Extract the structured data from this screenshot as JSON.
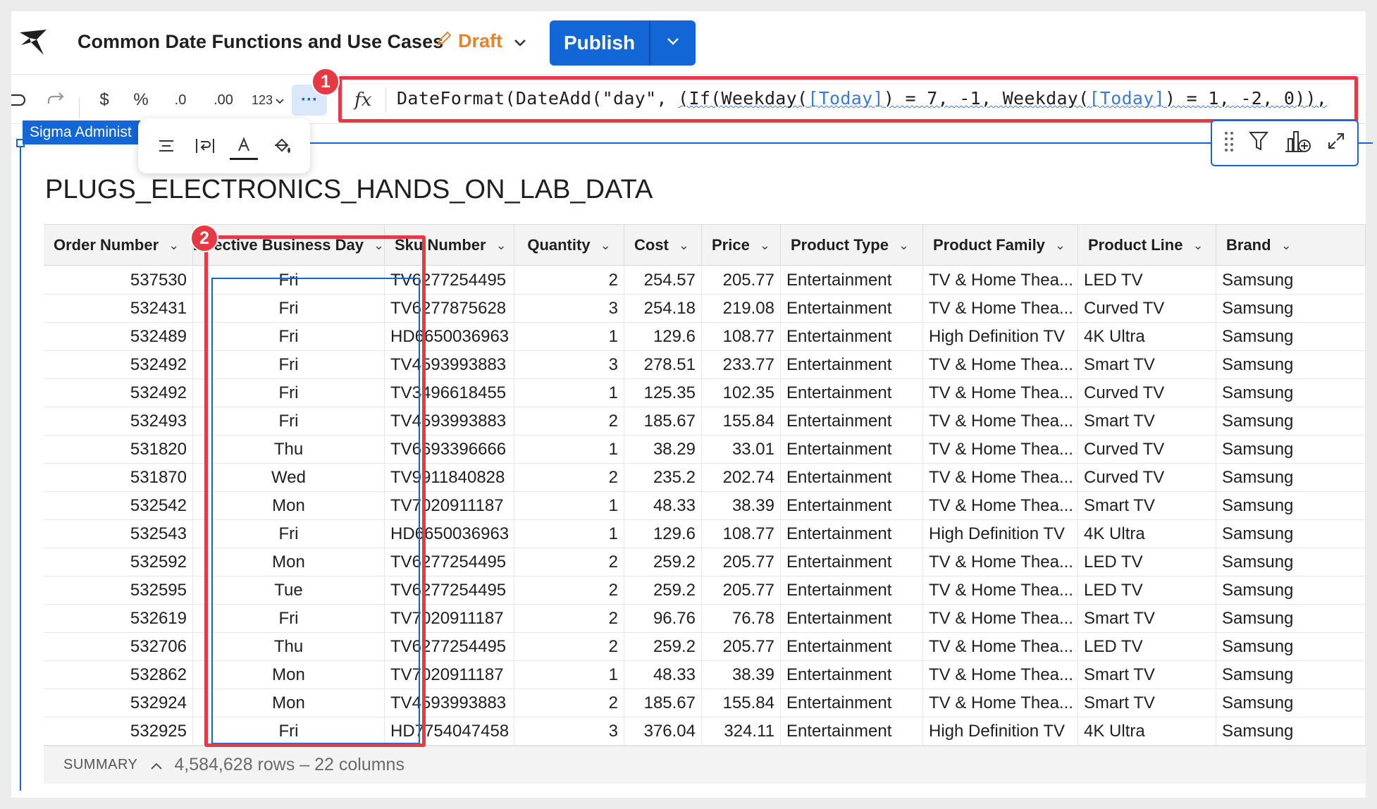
{
  "header": {
    "title": "Common Date Functions and Use Cases",
    "draft_label": "Draft",
    "publish_label": "Publish"
  },
  "toolbar": {
    "currency": "$",
    "percent": "%",
    "dec_less": ".0",
    "dec_more": ".00",
    "number_fmt": "123",
    "more": "···",
    "fx": "fx"
  },
  "formula": {
    "p1": "DateFormat(DateAdd(\"day\", ",
    "p2": "(If(Weekday(",
    "col1": "[Today]",
    "p3": ") = 7, -1, Weekday(",
    "col2": "[Today]",
    "p4": ") = 1, -2, 0)),"
  },
  "badges": {
    "one": "1",
    "two": "2"
  },
  "element_tag": "Sigma Administ",
  "format_popover": [
    "align",
    "wrap",
    "text-color",
    "fill-color"
  ],
  "table": {
    "title": "PLUGS_ELECTRONICS_HANDS_ON_LAB_DATA",
    "columns": [
      "Order Number",
      "Effective Business Day",
      "Sku Number",
      "Quantity",
      "Cost",
      "Price",
      "Product Type",
      "Product Family",
      "Product Line",
      "Brand"
    ],
    "rows": [
      [
        "537530",
        "Fri",
        "TV6277254495",
        "2",
        "254.57",
        "205.77",
        "Entertainment",
        "TV & Home Thea...",
        "LED TV",
        "Samsung"
      ],
      [
        "532431",
        "Fri",
        "TV6277875628",
        "3",
        "254.18",
        "219.08",
        "Entertainment",
        "TV & Home Thea...",
        "Curved TV",
        "Samsung"
      ],
      [
        "532489",
        "Fri",
        "HD6650036963",
        "1",
        "129.6",
        "108.77",
        "Entertainment",
        "High Definition TV",
        "4K Ultra",
        "Samsung"
      ],
      [
        "532492",
        "Fri",
        "TV4593993883",
        "3",
        "278.51",
        "233.77",
        "Entertainment",
        "TV & Home Thea...",
        "Smart TV",
        "Samsung"
      ],
      [
        "532492",
        "Fri",
        "TV3496618455",
        "1",
        "125.35",
        "102.35",
        "Entertainment",
        "TV & Home Thea...",
        "Curved TV",
        "Samsung"
      ],
      [
        "532493",
        "Fri",
        "TV4593993883",
        "2",
        "185.67",
        "155.84",
        "Entertainment",
        "TV & Home Thea...",
        "Smart TV",
        "Samsung"
      ],
      [
        "531820",
        "Thu",
        "TV6693396666",
        "1",
        "38.29",
        "33.01",
        "Entertainment",
        "TV & Home Thea...",
        "Curved TV",
        "Samsung"
      ],
      [
        "531870",
        "Wed",
        "TV9911840828",
        "2",
        "235.2",
        "202.74",
        "Entertainment",
        "TV & Home Thea...",
        "Curved TV",
        "Samsung"
      ],
      [
        "532542",
        "Mon",
        "TV7020911187",
        "1",
        "48.33",
        "38.39",
        "Entertainment",
        "TV & Home Thea...",
        "Smart TV",
        "Samsung"
      ],
      [
        "532543",
        "Fri",
        "HD6650036963",
        "1",
        "129.6",
        "108.77",
        "Entertainment",
        "High Definition TV",
        "4K Ultra",
        "Samsung"
      ],
      [
        "532592",
        "Mon",
        "TV6277254495",
        "2",
        "259.2",
        "205.77",
        "Entertainment",
        "TV & Home Thea...",
        "LED TV",
        "Samsung"
      ],
      [
        "532595",
        "Tue",
        "TV6277254495",
        "2",
        "259.2",
        "205.77",
        "Entertainment",
        "TV & Home Thea...",
        "LED TV",
        "Samsung"
      ],
      [
        "532619",
        "Fri",
        "TV7020911187",
        "2",
        "96.76",
        "76.78",
        "Entertainment",
        "TV & Home Thea...",
        "Smart TV",
        "Samsung"
      ],
      [
        "532706",
        "Thu",
        "TV6277254495",
        "2",
        "259.2",
        "205.77",
        "Entertainment",
        "TV & Home Thea...",
        "LED TV",
        "Samsung"
      ],
      [
        "532862",
        "Mon",
        "TV7020911187",
        "1",
        "48.33",
        "38.39",
        "Entertainment",
        "TV & Home Thea...",
        "Smart TV",
        "Samsung"
      ],
      [
        "532924",
        "Mon",
        "TV4593993883",
        "2",
        "185.67",
        "155.84",
        "Entertainment",
        "TV & Home Thea...",
        "Smart TV",
        "Samsung"
      ],
      [
        "532925",
        "Fri",
        "HD7754047458",
        "3",
        "376.04",
        "324.11",
        "Entertainment",
        "High Definition TV",
        "4K Ultra",
        "Samsung"
      ]
    ]
  },
  "summary": {
    "label": "SUMMARY",
    "count": "4,584,628 rows – 22 columns"
  },
  "colors": {
    "accent": "#1366d6",
    "draft": "#e8812d",
    "highlight": "#e53943"
  }
}
